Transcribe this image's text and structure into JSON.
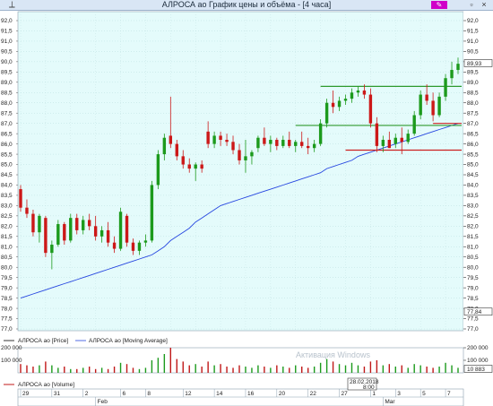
{
  "window": {
    "title": "АЛРОСА ао График цены и объёма - [4 часа]",
    "pin_icon": "pin-icon",
    "edit_icon": "pencil-icon",
    "restore_symbol": "▫",
    "close_symbol": "×"
  },
  "colors": {
    "background": "#e4fbfb",
    "price_line": "#000000",
    "moving_average": "#2646e0",
    "up_candle": "#1c9a1c",
    "down_candle": "#cc1818",
    "support_lines": "#2e9a2e",
    "resistance_red": "#cc2020",
    "volume_bar": "#c01818"
  },
  "price_axis": {
    "labels": [
      "92,0",
      "91,5",
      "91,0",
      "90,5",
      "90,0",
      "89,5",
      "89,0",
      "88,5",
      "88,0",
      "87,5",
      "87,0",
      "86,5",
      "86,0",
      "85,5",
      "85,0",
      "84,5",
      "84,0",
      "83,5",
      "83,0",
      "82,5",
      "82,0",
      "81,5",
      "81,0",
      "80,5",
      "80,0",
      "79,5",
      "79,0",
      "78,5",
      "78,0",
      "77,5",
      "77,0"
    ],
    "last_price": "89,93",
    "ma_value": "77,84"
  },
  "legend": {
    "price": "АЛРОСА ао [Price]",
    "ma": "АЛРОСА ао [Moving Average]"
  },
  "volume_axis": {
    "labels": [
      "200 000",
      "100 000"
    ],
    "last_value": "10 883"
  },
  "volume_legend": "АЛРОСА ао [Volume]",
  "time_axis": {
    "day_labels": [
      "29",
      "31",
      "2",
      "6",
      "8",
      "12",
      "14",
      "16",
      "20",
      "22",
      "27",
      "1",
      "3",
      "5",
      "7"
    ],
    "month_labels": [
      "Feb",
      "Mar"
    ]
  },
  "tooltip": {
    "date": "28.02.2018",
    "time": "8:00"
  },
  "watermark": "Активация Windows",
  "chart_data": {
    "type": "candlestick",
    "title": "АЛРОСА ао График цены и объёма - [4 часа]",
    "y_range": [
      77.0,
      92.0
    ],
    "volume_range": [
      0,
      200000
    ],
    "series": [
      {
        "name": "АЛРОСА ао [Price]",
        "ohlc": [
          [
            83.8,
            84.0,
            82.7,
            82.9
          ],
          [
            82.9,
            83.3,
            82.4,
            82.6
          ],
          [
            82.6,
            82.8,
            81.5,
            81.7
          ],
          [
            81.7,
            82.6,
            81.2,
            82.5
          ],
          [
            82.4,
            82.5,
            80.5,
            80.7
          ],
          [
            80.7,
            81.3,
            79.9,
            81.1
          ],
          [
            81.1,
            82.3,
            81.0,
            82.1
          ],
          [
            82.1,
            82.2,
            81.1,
            81.3
          ],
          [
            81.3,
            82.6,
            81.2,
            82.4
          ],
          [
            82.4,
            82.6,
            81.6,
            81.8
          ],
          [
            81.8,
            82.5,
            81.6,
            82.3
          ],
          [
            82.3,
            82.6,
            81.8,
            82.0
          ],
          [
            82.0,
            82.5,
            81.3,
            81.5
          ],
          [
            81.5,
            82.0,
            81.2,
            81.8
          ],
          [
            81.8,
            82.2,
            81.0,
            81.2
          ],
          [
            81.2,
            81.5,
            80.7,
            80.9
          ],
          [
            80.9,
            82.9,
            80.8,
            82.7
          ],
          [
            82.5,
            82.6,
            81.0,
            81.2
          ],
          [
            81.2,
            81.4,
            80.6,
            80.8
          ],
          [
            80.8,
            81.3,
            80.6,
            81.2
          ],
          [
            81.2,
            81.6,
            81.0,
            81.3
          ],
          [
            81.3,
            84.2,
            81.2,
            84.0
          ],
          [
            84.0,
            85.7,
            83.8,
            85.5
          ],
          [
            85.5,
            86.5,
            85.2,
            86.3
          ],
          [
            86.4,
            88.3,
            85.8,
            86.0
          ],
          [
            86.0,
            86.2,
            85.2,
            85.4
          ],
          [
            85.4,
            85.7,
            84.8,
            85.0
          ],
          [
            85.0,
            85.3,
            84.6,
            84.8
          ],
          [
            84.8,
            85.1,
            84.2,
            85.0
          ],
          [
            85.0,
            85.2,
            84.6,
            84.8
          ],
          [
            86.6,
            87.1,
            85.8,
            86.0
          ],
          [
            86.0,
            86.6,
            85.8,
            86.4
          ],
          [
            86.4,
            86.6,
            85.9,
            86.2
          ],
          [
            86.2,
            86.5,
            85.9,
            86.1
          ],
          [
            86.1,
            86.4,
            85.5,
            85.7
          ],
          [
            85.7,
            86.0,
            85.0,
            85.2
          ],
          [
            85.2,
            86.2,
            84.6,
            85.4
          ],
          [
            85.4,
            85.7,
            85.0,
            85.6
          ],
          [
            85.8,
            86.4,
            85.6,
            86.3
          ],
          [
            86.3,
            86.8,
            85.9,
            86.0
          ],
          [
            86.0,
            86.4,
            85.6,
            86.2
          ],
          [
            86.2,
            86.3,
            85.7,
            85.9
          ],
          [
            85.9,
            86.4,
            85.8,
            86.2
          ],
          [
            86.2,
            86.6,
            85.8,
            85.9
          ],
          [
            85.9,
            86.2,
            85.6,
            86.1
          ],
          [
            86.1,
            86.6,
            85.8,
            85.9
          ],
          [
            85.9,
            86.3,
            85.5,
            85.8
          ],
          [
            85.8,
            86.2,
            85.6,
            86.0
          ],
          [
            86.0,
            87.2,
            85.9,
            87.0
          ],
          [
            87.0,
            88.2,
            86.8,
            88.0
          ],
          [
            88.0,
            88.6,
            87.5,
            87.8
          ],
          [
            87.8,
            88.3,
            87.6,
            88.1
          ],
          [
            88.1,
            88.4,
            87.9,
            88.2
          ],
          [
            88.2,
            88.7,
            88.0,
            88.5
          ],
          [
            88.5,
            88.8,
            88.3,
            88.6
          ],
          [
            88.6,
            88.9,
            88.2,
            88.4
          ],
          [
            88.4,
            88.7,
            86.8,
            87.0
          ],
          [
            87.0,
            87.3,
            85.6,
            85.9
          ],
          [
            85.9,
            86.4,
            85.6,
            86.2
          ],
          [
            86.2,
            86.6,
            85.8,
            85.8
          ],
          [
            86.0,
            86.5,
            85.8,
            86.3
          ],
          [
            86.3,
            86.8,
            85.5,
            86.1
          ],
          [
            86.1,
            86.7,
            86.0,
            86.5
          ],
          [
            86.5,
            87.6,
            86.4,
            87.4
          ],
          [
            87.4,
            88.6,
            87.2,
            88.4
          ],
          [
            88.4,
            88.9,
            87.9,
            88.1
          ],
          [
            88.1,
            88.5,
            87.1,
            87.4
          ],
          [
            87.4,
            88.5,
            87.3,
            88.3
          ],
          [
            88.3,
            89.4,
            88.1,
            89.2
          ],
          [
            89.2,
            90.0,
            88.9,
            89.6
          ],
          [
            89.6,
            90.2,
            89.4,
            89.9
          ]
        ]
      },
      {
        "name": "АЛРОСА ао [Moving Average]",
        "values": [
          78.5,
          78.6,
          78.7,
          78.8,
          78.9,
          79.0,
          79.1,
          79.2,
          79.3,
          79.4,
          79.5,
          79.6,
          79.7,
          79.8,
          79.9,
          80.0,
          80.1,
          80.2,
          80.3,
          80.4,
          80.5,
          80.6,
          80.8,
          81.0,
          81.3,
          81.5,
          81.7,
          81.9,
          82.2,
          82.4,
          82.6,
          82.8,
          83.0,
          83.1,
          83.2,
          83.3,
          83.4,
          83.5,
          83.6,
          83.7,
          83.8,
          83.9,
          84.0,
          84.1,
          84.2,
          84.3,
          84.4,
          84.5,
          84.6,
          84.8,
          84.9,
          85.0,
          85.1,
          85.2,
          85.4,
          85.5,
          85.6,
          85.7,
          85.8,
          85.9,
          86.0,
          86.1,
          86.2,
          86.3,
          86.4,
          86.5,
          86.6,
          86.7,
          86.8,
          86.9,
          87.0
        ]
      },
      {
        "name": "АЛРОСА ао [Volume]",
        "values": [
          70000,
          60000,
          50000,
          60000,
          90000,
          60000,
          40000,
          50000,
          30000,
          30000,
          40000,
          50000,
          30000,
          40000,
          30000,
          50000,
          80000,
          70000,
          40000,
          30000,
          40000,
          100000,
          120000,
          150000,
          200000,
          110000,
          90000,
          60000,
          70000,
          50000,
          90000,
          60000,
          70000,
          50000,
          40000,
          60000,
          50000,
          40000,
          60000,
          50000,
          40000,
          60000,
          50000,
          40000,
          60000,
          50000,
          40000,
          50000,
          80000,
          110000,
          90000,
          70000,
          60000,
          80000,
          60000,
          50000,
          90000,
          100000,
          60000,
          70000,
          50000,
          60000,
          40000,
          70000,
          60000,
          50000,
          40000,
          50000,
          80000,
          60000,
          40000
        ]
      }
    ],
    "horizontal_lines": [
      {
        "price": 88.8,
        "color": "green",
        "start_index": 48,
        "end_index": 70
      },
      {
        "price": 86.9,
        "color": "green",
        "start_index": 44,
        "end_index": 70
      },
      {
        "price": 85.7,
        "color": "red",
        "start_index": 52,
        "end_index": 70
      },
      {
        "price": 87.0,
        "color": "red",
        "start_index": 66,
        "end_index": 70
      }
    ],
    "xlabel": "",
    "ylabel": "",
    "grid": true
  }
}
